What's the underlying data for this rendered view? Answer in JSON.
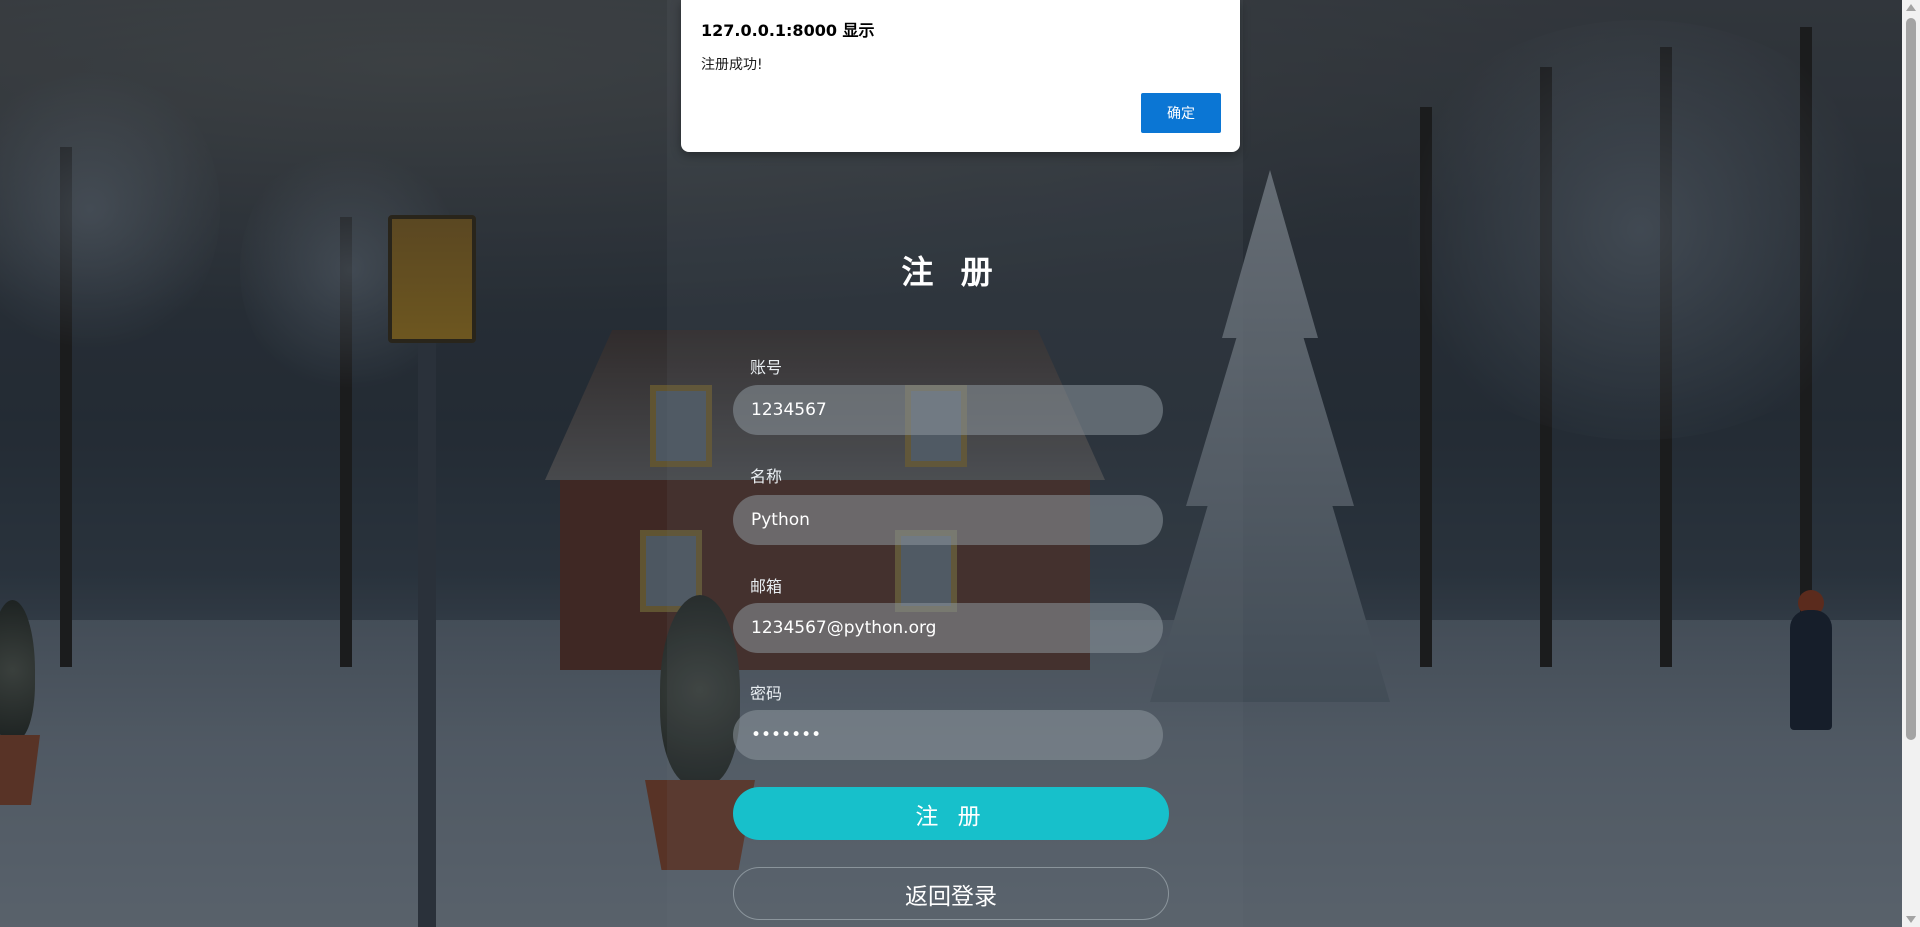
{
  "dialog": {
    "title": "127.0.0.1:8000 显示",
    "message": "注册成功!",
    "ok_label": "确定"
  },
  "form": {
    "title": "注 册",
    "fields": [
      {
        "label": "账号",
        "value": "1234567",
        "type": "text"
      },
      {
        "label": "名称",
        "value": "Python",
        "type": "text"
      },
      {
        "label": "邮箱",
        "value": "1234567@python.org",
        "type": "text"
      },
      {
        "label": "密码",
        "value": "1234567",
        "type": "password"
      }
    ],
    "submit_label": "注 册",
    "back_label": "返回登录"
  },
  "colors": {
    "accent": "#17c0cb",
    "dialog_button": "#0b76d4"
  }
}
